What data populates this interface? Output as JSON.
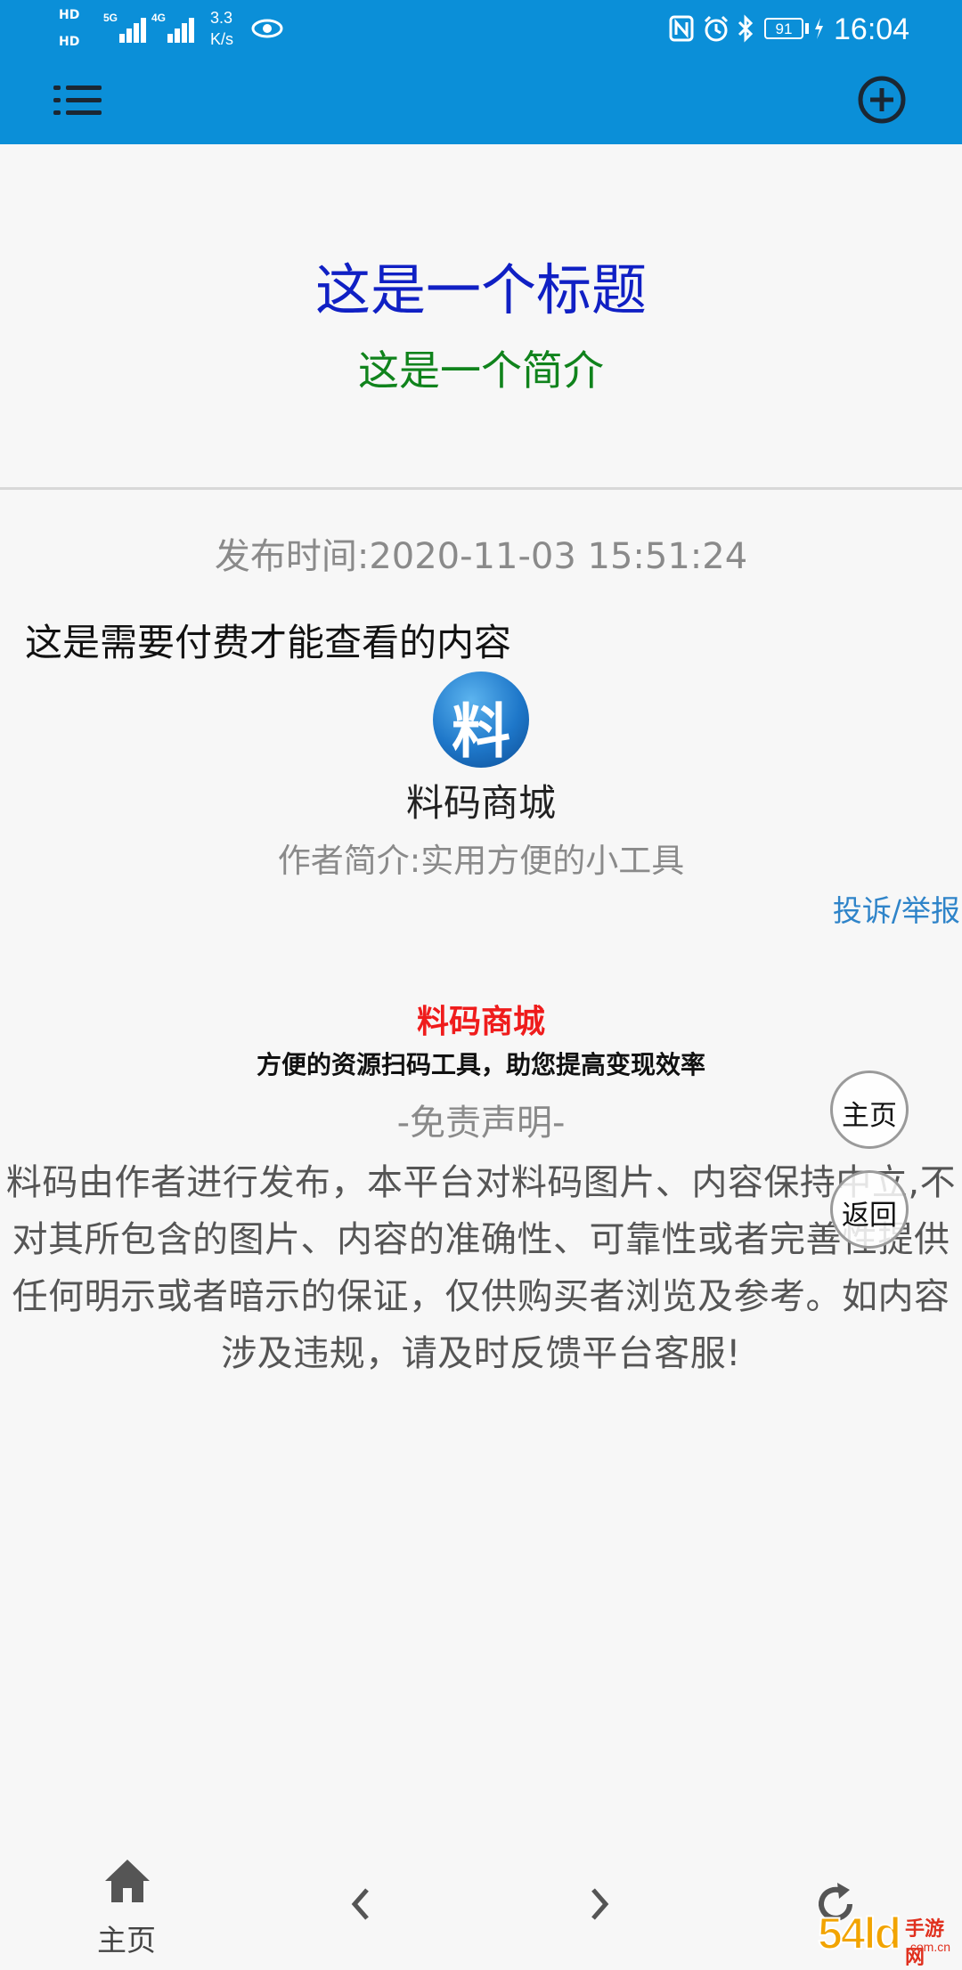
{
  "status_bar": {
    "network_type_1": "HD",
    "network_type_2": "HD",
    "signal_1_label": "5G",
    "signal_2_label": "4G",
    "speed_value": "3.3",
    "speed_unit": "K/s",
    "battery": "91",
    "time": "16:04"
  },
  "appbar": {
    "menu_icon": "menu-icon",
    "add_icon": "add-circle-icon",
    "background_color": "#0b8fd8"
  },
  "header": {
    "title": "这是一个标题",
    "subtitle": "这是一个简介",
    "title_color": "#1020c4",
    "subtitle_color": "#10831c"
  },
  "content": {
    "publish_time": "发布时间:2020-11-03 15:51:24",
    "paid_notice": "这是需要付费才能查看的内容",
    "logo_char": "料",
    "store_name": "料码商城",
    "author_bio": "作者简介:实用方便的小工具",
    "report_link": "投诉/举报",
    "brand": "料码商城",
    "tagline": "方便的资源扫码工具，助您提高变现效率",
    "disclaimer_title": "-免责声明-",
    "disclaimer_text": "料码由作者进行发布，本平台对料码图片、内容保持中立,不对其所包含的图片、内容的准确性、可靠性或者完善性提供任何明示或者暗示的保证，仅供购买者浏览及参考。如内容涉及违规，请及时反馈平台客服!"
  },
  "floating": {
    "home": "主页",
    "back": "返回"
  },
  "bottom_nav": {
    "home_label": "主页",
    "home_icon": "home-icon",
    "back_icon": "chevron-left-icon",
    "forward_icon": "chevron-right-icon",
    "refresh_icon": "refresh-icon"
  },
  "watermark": {
    "text": "54ld手游网",
    "domain": ".com.cn"
  }
}
